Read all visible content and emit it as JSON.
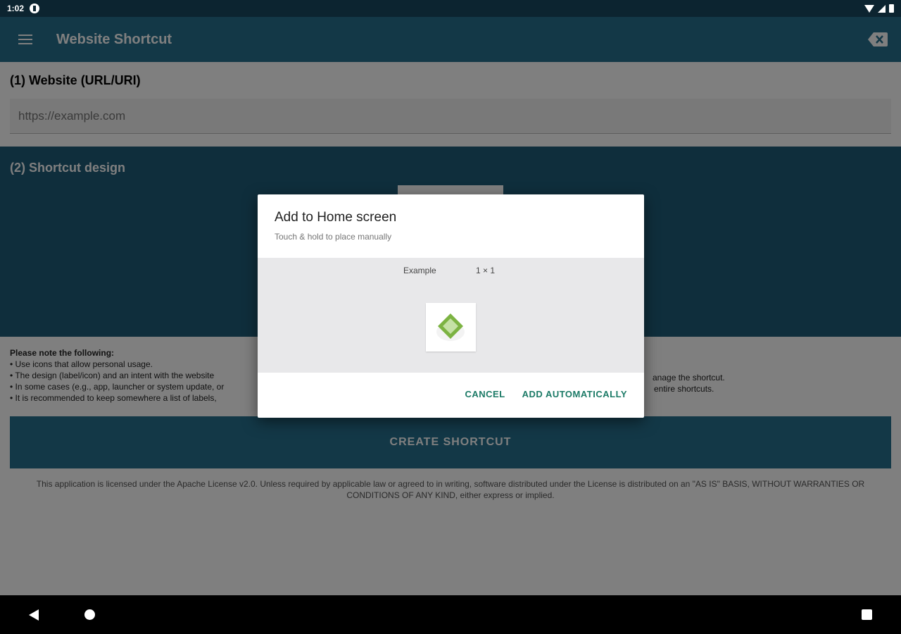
{
  "status_bar": {
    "time": "1:02"
  },
  "app_bar": {
    "title": "Website Shortcut"
  },
  "section1": {
    "title": "(1) Website (URL/URI)",
    "url_placeholder": "https://example.com"
  },
  "section2": {
    "title": "(2) Shortcut design"
  },
  "notes": {
    "title": "Please note the following:",
    "items": [
      "• Use icons that allow personal usage.",
      "• The design (label/icon) and an intent with the website",
      "• In some cases (e.g., app, launcher or system update, or",
      "• It is recommended to keep somewhere a list of labels,"
    ],
    "right_fragments": [
      "anage the shortcut.",
      "entire shortcuts."
    ]
  },
  "create_button": {
    "label": "CREATE SHORTCUT"
  },
  "license_text": "This application is licensed under the Apache License v2.0. Unless required by applicable law or agreed to in writing, software distributed under the License is distributed on an \"AS IS\" BASIS, WITHOUT WARRANTIES OR CONDITIONS OF ANY KIND, either express or implied.",
  "dialog": {
    "title": "Add to Home screen",
    "subtitle": "Touch & hold to place manually",
    "preview_name": "Example",
    "preview_size": "1 × 1",
    "cancel_label": "CANCEL",
    "confirm_label": "ADD AUTOMATICALLY"
  },
  "colors": {
    "primary": "#27708f",
    "section_dark": "#1f5c78",
    "accent_button_text": "#1b7a66",
    "icon_green": "#7cb342"
  }
}
